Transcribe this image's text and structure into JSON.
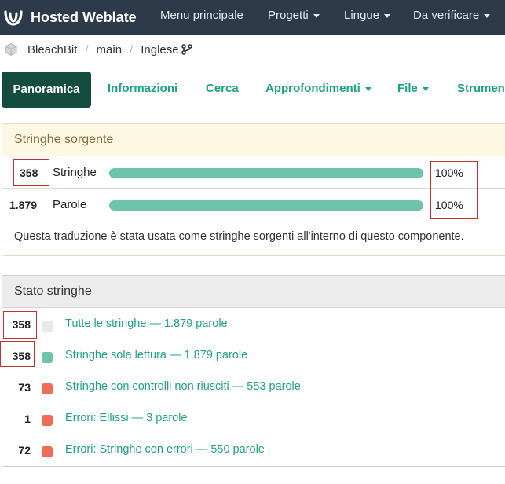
{
  "navbar": {
    "brand": "Hosted Weblate",
    "items": [
      {
        "label": "Menu principale",
        "dropdown": false
      },
      {
        "label": "Progetti",
        "dropdown": true
      },
      {
        "label": "Lingue",
        "dropdown": true
      },
      {
        "label": "Da verificare",
        "dropdown": true
      }
    ]
  },
  "breadcrumb": {
    "project": "BleachBit",
    "component": "main",
    "language": "Inglese"
  },
  "tabs": [
    {
      "label": "Panoramica",
      "active": true
    },
    {
      "label": "Informazioni"
    },
    {
      "label": "Cerca"
    },
    {
      "label": "Approfondimenti",
      "dropdown": true
    },
    {
      "label": "File",
      "dropdown": true
    },
    {
      "label": "Strument"
    }
  ],
  "source_panel": {
    "title": "Stringhe sorgente",
    "rows": [
      {
        "count": "358",
        "label": "Stringhe",
        "percent": "100%",
        "fill": 1.0
      },
      {
        "count": "1.879",
        "label": "Parole",
        "percent": "100%",
        "fill": 1.0
      }
    ],
    "note": "Questa traduzione è stata usata come stringhe sorgenti all'interno di questo componente."
  },
  "status_panel": {
    "title": "Stato stringhe",
    "rows": [
      {
        "count": "358",
        "label": "Tutte le stringhe — 1.879 parole",
        "color": "#e9e9e9"
      },
      {
        "count": "358",
        "label": "Stringhe sola lettura — 1.879 parole",
        "color": "#6ec4aa"
      },
      {
        "count": "73",
        "label": "Stringhe con controlli non riusciti — 553 parole",
        "color": "#f16b57"
      },
      {
        "count": "1",
        "label": "Errori: Ellissi — 3 parole",
        "color": "#f16b57"
      },
      {
        "count": "72",
        "label": "Errori: Stringhe con errori — 550 parole",
        "color": "#f16b57"
      }
    ]
  },
  "colors": {
    "navbar": "#2d3a4a",
    "accent": "#1fa385",
    "active_tab": "#144d3f",
    "bar": "#6ec4aa",
    "warning_heading": "#fcf8e3",
    "annotation": "#c9302c"
  }
}
